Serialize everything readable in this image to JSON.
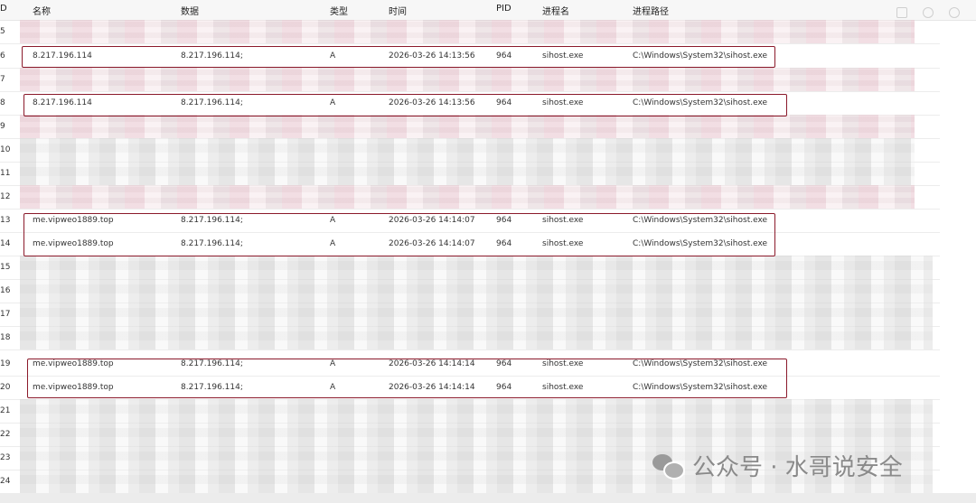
{
  "headers": {
    "id": "D",
    "name": "名称",
    "data": "数据",
    "type": "类型",
    "time": "时间",
    "pid": "PID",
    "process": "进程名",
    "path": "进程路径"
  },
  "rows": [
    {
      "id": "5",
      "blurred": true
    },
    {
      "id": "6",
      "name": "8.217.196.114",
      "data": "8.217.196.114;",
      "type": "A",
      "time": "2026-03-26 14:13:56",
      "pid": "964",
      "process": "sihost.exe",
      "path": "C:\\Windows\\System32\\sihost.exe"
    },
    {
      "id": "7",
      "blurred": true
    },
    {
      "id": "8",
      "name": "8.217.196.114",
      "data": "8.217.196.114;",
      "type": "A",
      "time": "2026-03-26 14:13:56",
      "pid": "964",
      "process": "sihost.exe",
      "path": "C:\\Windows\\System32\\sihost.exe"
    },
    {
      "id": "9",
      "blurred": true
    },
    {
      "id": "10",
      "blurred": true
    },
    {
      "id": "11",
      "blurred": true
    },
    {
      "id": "12",
      "blurred": true
    },
    {
      "id": "13",
      "name": "me.vipweo1889.top",
      "data": "8.217.196.114;",
      "type": "A",
      "time": "2026-03-26 14:14:07",
      "pid": "964",
      "process": "sihost.exe",
      "path": "C:\\Windows\\System32\\sihost.exe"
    },
    {
      "id": "14",
      "name": "me.vipweo1889.top",
      "data": "8.217.196.114;",
      "type": "A",
      "time": "2026-03-26 14:14:07",
      "pid": "964",
      "process": "sihost.exe",
      "path": "C:\\Windows\\System32\\sihost.exe"
    },
    {
      "id": "15",
      "blurred": true
    },
    {
      "id": "16",
      "blurred": true
    },
    {
      "id": "17",
      "blurred": true
    },
    {
      "id": "18",
      "blurred": true
    },
    {
      "id": "19",
      "name": "me.vipweo1889.top",
      "data": "8.217.196.114;",
      "type": "A",
      "time": "2026-03-26 14:14:14",
      "pid": "964",
      "process": "sihost.exe",
      "path": "C:\\Windows\\System32\\sihost.exe"
    },
    {
      "id": "20",
      "name": "me.vipweo1889.top",
      "data": "8.217.196.114;",
      "type": "A",
      "time": "2026-03-26 14:14:14",
      "pid": "964",
      "process": "sihost.exe",
      "path": "C:\\Windows\\System32\\sihost.exe"
    },
    {
      "id": "21",
      "blurred": true
    },
    {
      "id": "22",
      "blurred": true
    },
    {
      "id": "23",
      "blurred": true
    },
    {
      "id": "24",
      "blurred": true
    }
  ],
  "watermark": {
    "text": "公众号 · 水哥说安全",
    "icon": "wechat-icon"
  },
  "colors": {
    "highlight": "#8b1a2b"
  }
}
